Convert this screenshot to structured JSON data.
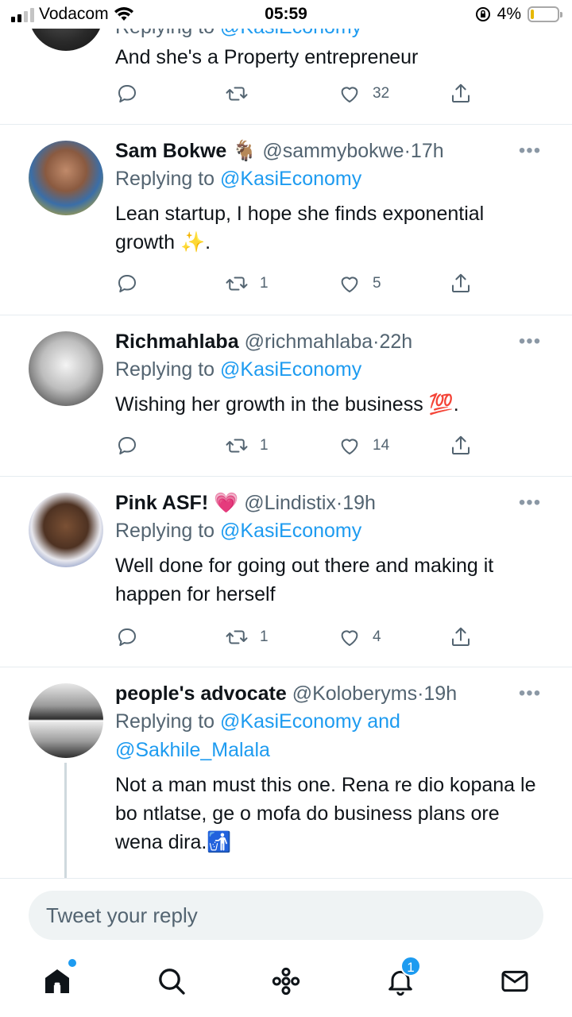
{
  "status_bar": {
    "carrier": "Vodacom",
    "time": "05:59",
    "battery_percent": "4%",
    "battery_level": 0.04
  },
  "tweets": [
    {
      "name": "",
      "handle": "",
      "time": "",
      "reply_prefix": "Replying to",
      "replying_to": "@KasiEconomy",
      "text": "And she's a Property entrepreneur",
      "replies": "",
      "retweets": "",
      "likes": "32"
    },
    {
      "name": "Sam Bokwe",
      "name_emoji": "🐐",
      "handle": "@sammybokwe",
      "time": "17h",
      "reply_prefix": "Replying to",
      "replying_to": "@KasiEconomy",
      "text": "Lean startup, I hope she finds exponential growth ✨.",
      "replies": "",
      "retweets": "1",
      "likes": "5"
    },
    {
      "name": "Richmahlaba",
      "handle": "@richmahlaba",
      "time": "22h",
      "reply_prefix": "Replying to",
      "replying_to": "@KasiEconomy",
      "text": "Wishing her growth in the business 💯.",
      "replies": "",
      "retweets": "1",
      "likes": "14"
    },
    {
      "name": "Pink ASF!",
      "name_emoji": "💗",
      "handle": "@Lindistix",
      "time": "19h",
      "reply_prefix": "Replying to",
      "replying_to": "@KasiEconomy",
      "text": "Well done for going out there and making it happen for herself",
      "replies": "",
      "retweets": "1",
      "likes": "4"
    },
    {
      "name": "people's advocate",
      "handle": "@Koloberyms",
      "time": "19h",
      "reply_prefix": "Replying to",
      "replying_to": "@KasiEconomy",
      "replying_and": "and",
      "replying_to_2": "@Sakhile_Malala",
      "text": "Not a man must this one. Rena re dio kopana le bo ntlatse, ge o mofa do business plans ore wena dira.🚮"
    }
  ],
  "dot_separator": "·",
  "more_glyph": "•••",
  "composer": {
    "placeholder": "Tweet your reply"
  },
  "bottom_nav": {
    "items": [
      "home-icon",
      "search-icon",
      "spaces-icon",
      "notifications-icon",
      "messages-icon"
    ],
    "notification_count": "1"
  },
  "colors": {
    "accent": "#1d9bf0",
    "secondary_text": "#536471",
    "divider": "#e6ecf0"
  }
}
